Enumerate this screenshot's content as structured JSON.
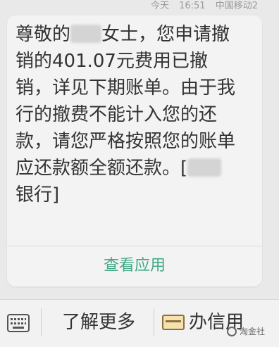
{
  "meta": {
    "day": "今天",
    "time": "16:51",
    "carrier": "中国移动2"
  },
  "message": {
    "line1_a": "尊敬的",
    "line1_b": "女士，您申请撤",
    "line2": "销的401.07元费用已撤",
    "line3": "销，详见下期账单。由于我",
    "line4": "行的撤费不能计入您的还",
    "line5": "款，请您严格按照您的账单",
    "line6_a": "应还款额全额还款。[",
    "line7": "银行]"
  },
  "actions": {
    "view_app": "查看应用"
  },
  "bottom_bar": {
    "learn_more": "了解更多",
    "apply_card": "办信用"
  },
  "watermark": {
    "text": "淘金社"
  },
  "colors": {
    "link": "#43a887",
    "background": "#e9e9e9",
    "card": "#f3f3f3"
  }
}
